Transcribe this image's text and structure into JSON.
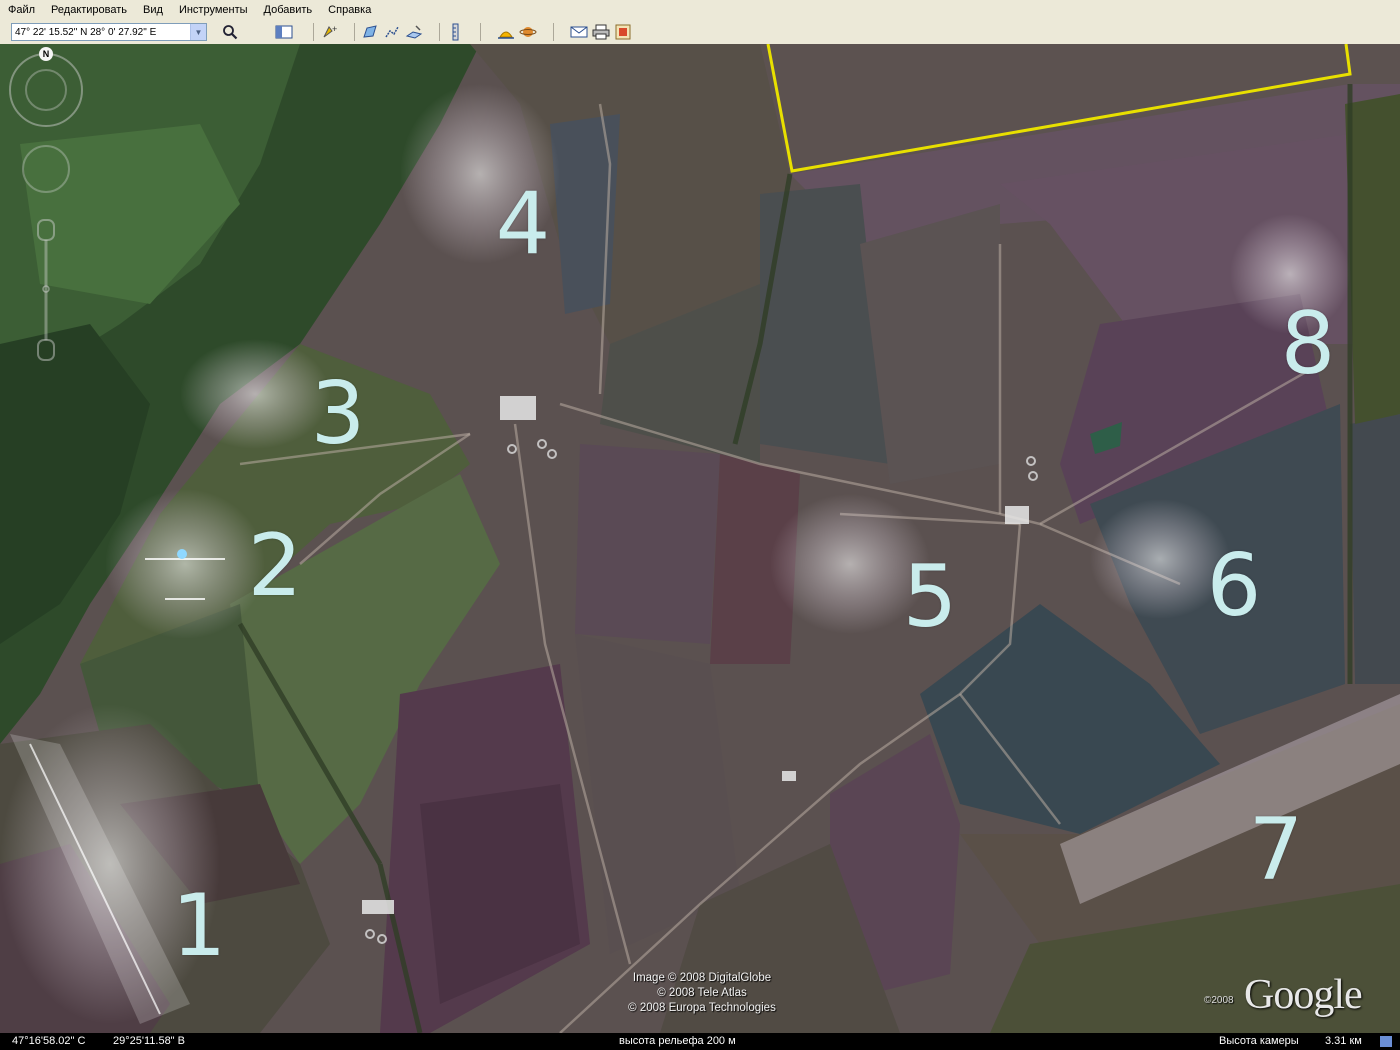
{
  "menu": {
    "items": [
      "Файл",
      "Редактировать",
      "Вид",
      "Инструменты",
      "Добавить",
      "Справка"
    ]
  },
  "toolbar": {
    "search_value": "47° 22' 15.52\" N 28° 0' 27.92\" E",
    "search_icon": "magnifier-icon",
    "buttons": [
      "sidebar-icon",
      "placemark-icon",
      "polygon-icon",
      "path-icon",
      "overlay-icon",
      "ruler-icon",
      "sun-icon",
      "planet-icon",
      "email-icon",
      "print-icon",
      "view-in-maps-icon"
    ]
  },
  "map": {
    "site_labels": [
      {
        "id": "site-1",
        "text": "1"
      },
      {
        "id": "site-2",
        "text": "2"
      },
      {
        "id": "site-3",
        "text": "3"
      },
      {
        "id": "site-4",
        "text": "4"
      },
      {
        "id": "site-5",
        "text": "5"
      },
      {
        "id": "site-6",
        "text": "6"
      },
      {
        "id": "site-7",
        "text": "7"
      },
      {
        "id": "site-8",
        "text": "8"
      }
    ],
    "attribution": [
      "Image © 2008 DigitalGlobe",
      "© 2008 Tele Atlas",
      "© 2008 Europa Technologies"
    ],
    "logo_year": "©2008",
    "logo_text": "Google",
    "compass_letter": "N",
    "boundary_color": "#e8e000",
    "label_color": "#c9ecec"
  },
  "status": {
    "lat": "47°16'58.02\" С",
    "lon": "29°25'11.58\" В",
    "elevation": "высота рельефа  200 м",
    "camera_label": "Высота камеры",
    "camera_value": "3.31 км"
  }
}
